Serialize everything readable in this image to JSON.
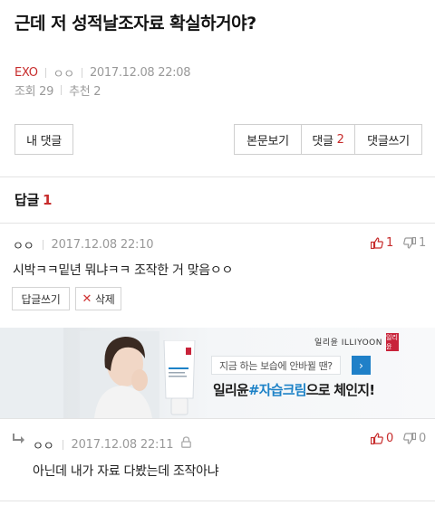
{
  "post": {
    "title": "근데 저 성적날조자료 확실하거야?",
    "author": "EXO",
    "nickname": "ㅇㅇ",
    "datetime": "2017.12.08 22:08",
    "views": "조회 29",
    "recommends": "추천 2"
  },
  "actions": {
    "my_comments": "내 댓글",
    "view_post": "본문보기",
    "comments_label": "댓글",
    "comments_count": "2",
    "write_comment": "댓글쓰기"
  },
  "replies": {
    "heading": "답글",
    "count": "1"
  },
  "comments": [
    {
      "nickname": "ㅇㅇ",
      "datetime": "2017.12.08 22:10",
      "upvotes": "1",
      "downvotes": "1",
      "text": "시박ㅋㅋ밑년 뭐냐ㅋㅋ 조작한 거 맞음ㅇㅇ",
      "reply_button": "답글쓰기",
      "delete_button": "삭제"
    },
    {
      "nickname": "ㅇㅇ",
      "datetime": "2017.12.08 22:11",
      "upvotes": "0",
      "downvotes": "0",
      "text": "아닌데 내가 자료 다봤는데 조작아냐"
    }
  ],
  "ad": {
    "brand": "일리윤 ILLIYOON",
    "logo_text": "일리윤",
    "question": "지금 하는 보습에 안바뀔 땐?",
    "slogan_brand": "일리윤",
    "slogan_highlight": "#자습크림",
    "slogan_rest": "으로 체인지!"
  },
  "icons": {
    "thumbs_up": "thumbs-up-icon",
    "thumbs_down": "thumbs-down-icon",
    "close": "close-icon",
    "reply_arrow": "reply-arrow-icon",
    "lock": "lock-icon",
    "chevron": "chevron-right-icon"
  },
  "colors": {
    "accent_red": "#c72c2c",
    "ad_blue": "#1d82c7",
    "text_gray": "#999999"
  }
}
